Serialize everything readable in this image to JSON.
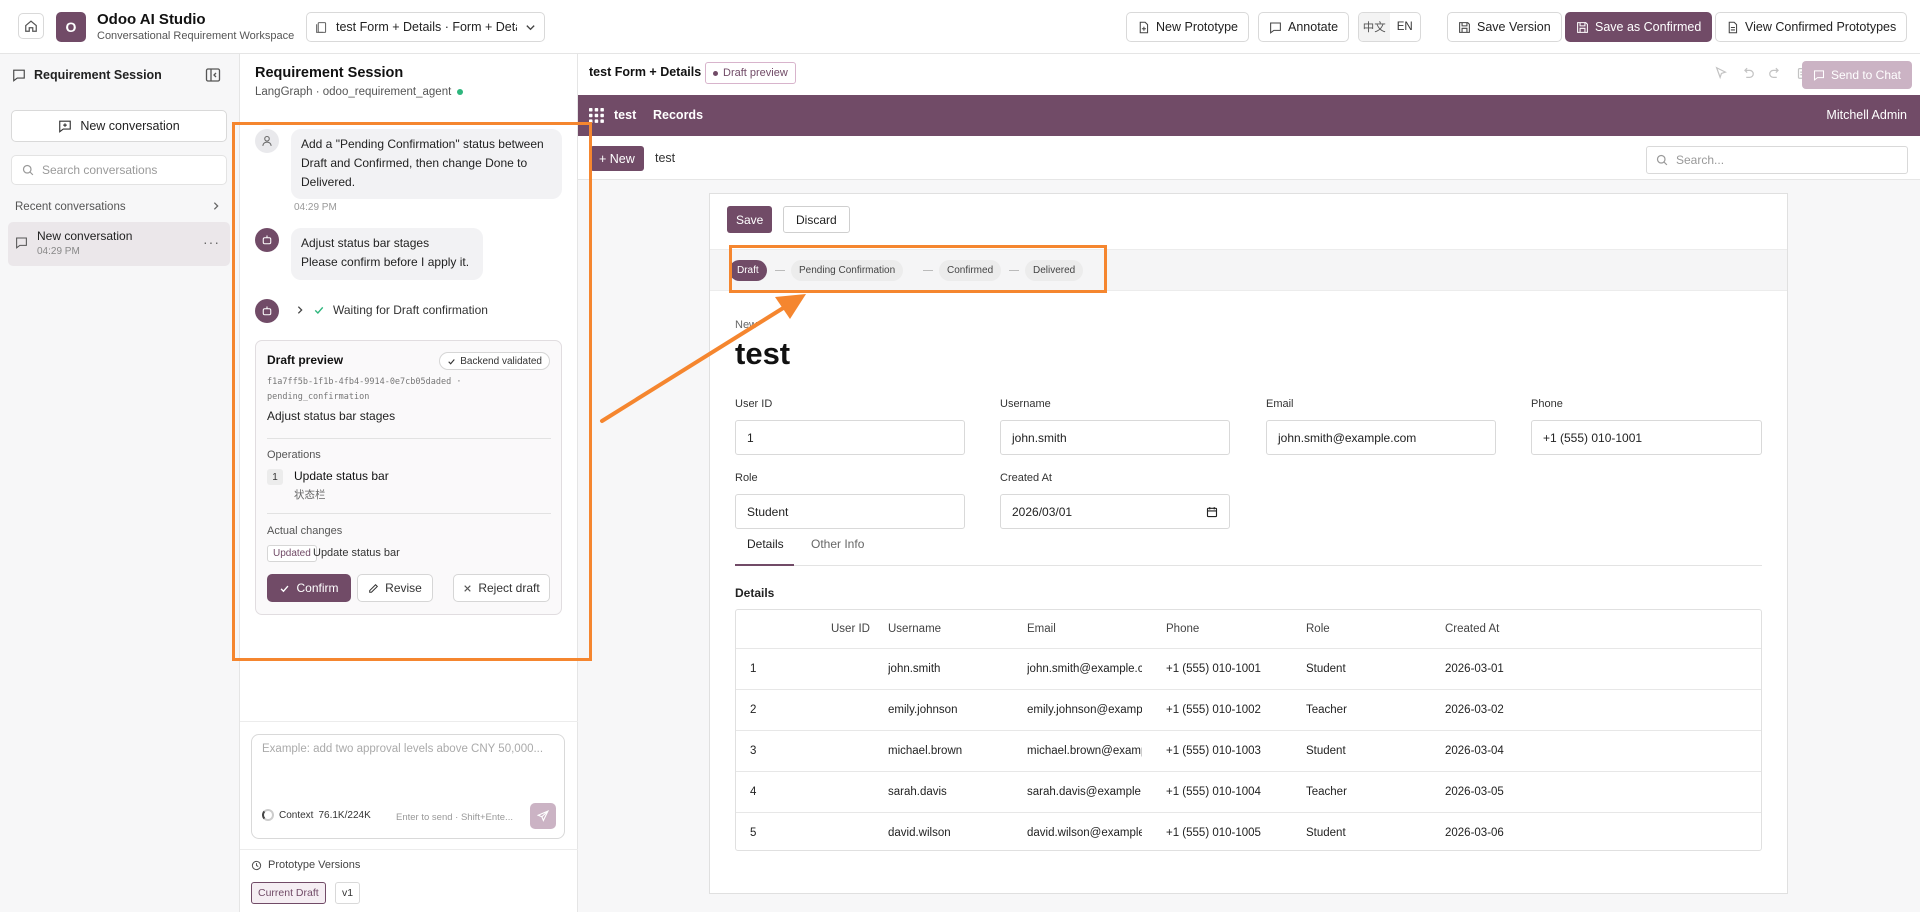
{
  "topbar": {
    "app_title": "Odoo AI Studio",
    "app_subtitle": "Conversational Requirement Workspace",
    "prototype_select": "test Form + Details · Form + Details",
    "new_prototype": "New Prototype",
    "annotate": "Annotate",
    "lang_zh": "中文",
    "lang_en": "EN",
    "save_version": "Save Version",
    "save_confirmed": "Save as Confirmed",
    "view_confirmed": "View Confirmed Prototypes"
  },
  "sidebar": {
    "title": "Requirement Session",
    "new_conversation": "New conversation",
    "search_placeholder": "Search conversations",
    "recent_label": "Recent conversations",
    "conversations": [
      {
        "title": "New conversation",
        "time": "04:29 PM"
      }
    ]
  },
  "chat": {
    "title": "Requirement Session",
    "subtitle": "LangGraph · odoo_requirement_agent",
    "user_message": "Add a \"Pending Confirmation\" status between Draft and Confirmed, then change Done to Delivered.",
    "user_time": "04:29 PM",
    "bot_line1": "Adjust status bar stages",
    "bot_line2": "Please confirm before I apply it.",
    "waiting": "Waiting for Draft confirmation",
    "draft": {
      "title": "Draft preview",
      "badge": "Backend validated",
      "id": "f1a7ff5b-1f1b-4fb4-9914-0e7cb05daded · pending_confirmation",
      "desc": "Adjust status bar stages",
      "operations_label": "Operations",
      "op_num": "1",
      "op_title": "Update status bar",
      "op_sub": "状态栏",
      "changes_label": "Actual changes",
      "change_badge": "Updated",
      "change_text": "Update status bar",
      "confirm": "Confirm",
      "revise": "Revise",
      "reject": "Reject draft"
    },
    "composer_placeholder": "Example: add two approval levels above CNY 50,000...",
    "context_label": "Context",
    "context_value": "76.1K/224K",
    "send_hint": "Enter to send · Shift+Ente...",
    "versions_label": "Prototype Versions",
    "versions": [
      "Current Draft",
      "v1"
    ]
  },
  "preview": {
    "title": "test Form + Details",
    "badge": "Draft preview",
    "send_to_chat": "Send to Chat",
    "nav_app": "test",
    "nav_menu": "Records",
    "nav_user": "Mitchell Admin",
    "new_btn": "+ New",
    "breadcrumb": "test",
    "search_placeholder": "Search...",
    "save": "Save",
    "discard": "Discard",
    "stages": [
      "Draft",
      "Pending Confirmation",
      "Confirmed",
      "Delivered"
    ],
    "active_stage": "Draft",
    "record_new_label": "New",
    "record_name": "test",
    "fields": {
      "user_id_label": "User ID",
      "user_id": "1",
      "username_label": "Username",
      "username": "john.smith",
      "email_label": "Email",
      "email": "john.smith@example.com",
      "phone_label": "Phone",
      "phone": "+1 (555) 010-1001",
      "role_label": "Role",
      "role": "Student",
      "created_label": "Created At",
      "created": "2026/03/01"
    },
    "tabs": [
      "Details",
      "Other Info"
    ],
    "details_title": "Details",
    "table": {
      "headers": [
        "User ID",
        "Username",
        "Email",
        "Phone",
        "Role",
        "Created At"
      ],
      "rows": [
        [
          "1",
          "john.smith",
          "john.smith@example.com",
          "+1 (555) 010-1001",
          "Student",
          "2026-03-01"
        ],
        [
          "2",
          "emily.johnson",
          "emily.johnson@example.c",
          "+1 (555) 010-1002",
          "Teacher",
          "2026-03-02"
        ],
        [
          "3",
          "michael.brown",
          "michael.brown@example.",
          "+1 (555) 010-1003",
          "Student",
          "2026-03-04"
        ],
        [
          "4",
          "sarah.davis",
          "sarah.davis@example.com",
          "+1 (555) 010-1004",
          "Teacher",
          "2026-03-05"
        ],
        [
          "5",
          "david.wilson",
          "david.wilson@example.co",
          "+1 (555) 010-1005",
          "Student",
          "2026-03-06"
        ]
      ]
    }
  },
  "colors": {
    "brand": "#714b67",
    "annotation": "#f5862f"
  }
}
